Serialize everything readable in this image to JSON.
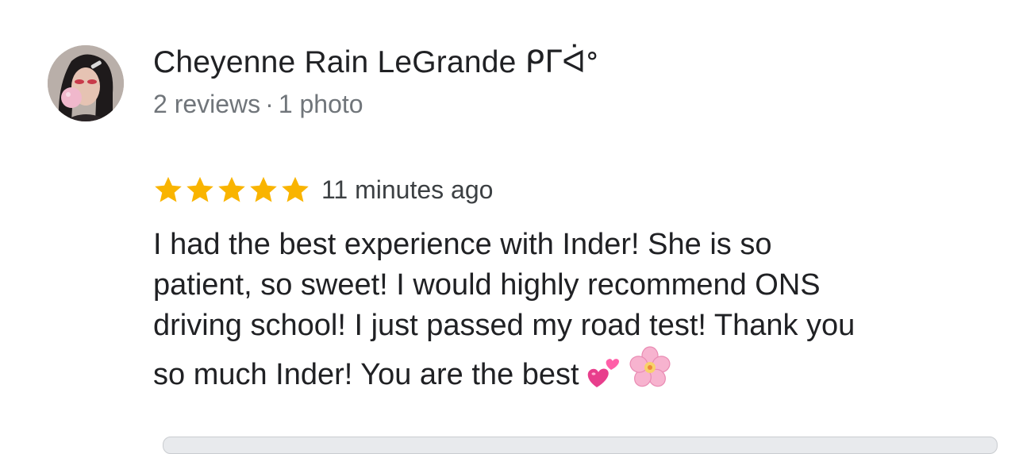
{
  "review": {
    "author": {
      "name": "Cheyenne Rain LeGrande ᑭᒥᐋᐤ",
      "reviews_count": "2 reviews",
      "separator": "·",
      "photos_count": "1 photo",
      "avatar_icon": "user-avatar-photo"
    },
    "rating": {
      "stars": 5,
      "max_stars": 5,
      "star_color": "#f9b400",
      "star_icon": "star-icon"
    },
    "time_ago": "11 minutes ago",
    "text_lines": [
      "I had the best experience with Inder! She is so",
      "patient, so sweet! I would highly recommend ONS",
      "driving school! I just passed my road test! Thank you",
      "so much Inder! You are the best"
    ],
    "emojis": [
      "two-hearts-emoji",
      "cherry-blossom-emoji"
    ]
  }
}
